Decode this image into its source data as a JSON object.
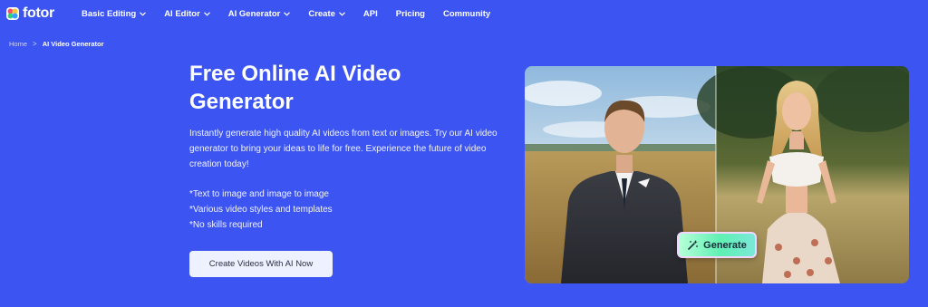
{
  "brand": {
    "name": "fotor"
  },
  "nav": {
    "items": [
      {
        "label": "Basic Editing",
        "dropdown": true
      },
      {
        "label": "AI Editor",
        "dropdown": true
      },
      {
        "label": "AI Generator",
        "dropdown": true
      },
      {
        "label": "Create",
        "dropdown": true
      },
      {
        "label": "API",
        "dropdown": false
      },
      {
        "label": "Pricing",
        "dropdown": false
      },
      {
        "label": "Community",
        "dropdown": false
      }
    ]
  },
  "breadcrumb": {
    "home": "Home",
    "separator": ">",
    "current": "AI Video Generator"
  },
  "hero": {
    "title": "Free Online AI Video Generator",
    "description": "Instantly generate high quality AI videos from text or images. Try our AI video generator to bring your ideas to life for free. Experience the future of video creation today!",
    "features": [
      "*Text to image and image to image",
      "*Various video styles and templates",
      "*No skills required"
    ],
    "cta_label": "Create Videos With AI Now",
    "generate_label": "Generate"
  },
  "colors": {
    "background": "#3c55f2",
    "cta_bg": "#eef1ff",
    "generate_accent": "#5ff0b3"
  }
}
